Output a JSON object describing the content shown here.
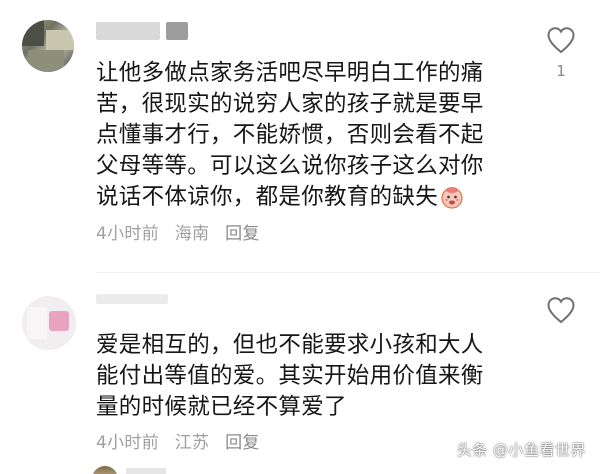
{
  "comments": [
    {
      "text_lines": [
        "让他多做点家务活吧尽早明白工作的痛",
        "苦，很现实的说穷人家的孩子就是要早",
        "点懂事才行，不能娇惯，否则会看不起",
        "父母等等。可以这么说你孩子这么对你",
        "说话不体谅你，都是你教育的缺失"
      ],
      "emoji": "face-emoji",
      "time": "4小时前",
      "location": "海南",
      "reply_label": "回复",
      "like_icon": "heart-outline-icon",
      "like_count": "1"
    },
    {
      "text_lines": [
        "爱是相互的，但也不能要求小孩和大人",
        "能付出等值的爱。其实开始用价值来衡",
        "量的时候就已经不算爱了"
      ],
      "time": "4小时前",
      "location": "江苏",
      "reply_label": "回复",
      "like_icon": "heart-outline-icon",
      "like_count": ""
    }
  ],
  "watermark": "头条 @小鱼看世界",
  "colors": {
    "text": "#161616",
    "meta": "#a0a0a0",
    "like_icon": "#707070",
    "background": "#ffffff"
  }
}
